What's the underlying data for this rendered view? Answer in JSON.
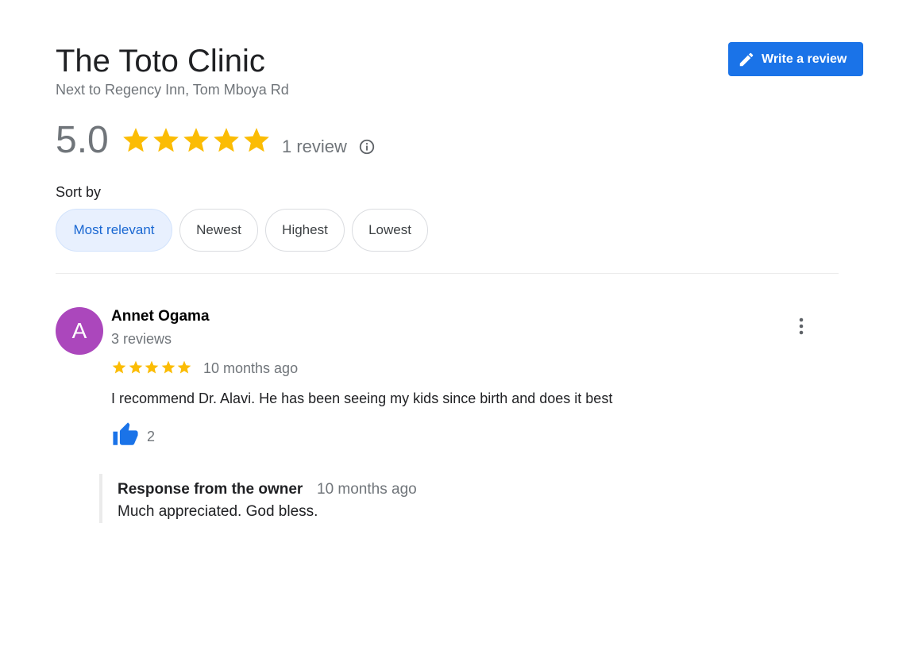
{
  "place": {
    "name": "The Toto Clinic",
    "address": "Next to Regency Inn, Tom Mboya Rd"
  },
  "actions": {
    "write_review_label": "Write a review",
    "write_review_icon": "pencil-icon"
  },
  "rating": {
    "score": "5.0",
    "stars": 5,
    "review_count": "1 review",
    "info_icon": "info-icon",
    "star_color": "#fbbc04"
  },
  "sort": {
    "label": "Sort by",
    "options": [
      "Most relevant",
      "Newest",
      "Highest",
      "Lowest"
    ],
    "selected": "Most relevant"
  },
  "review": {
    "avatar_letter": "A",
    "avatar_color": "#ab47bc",
    "author": "Annet Ogama",
    "author_reviews": "3 reviews",
    "stars": 5,
    "time": "10 months ago",
    "text": "I recommend Dr. Alavi. He has been seeing my kids since birth and does it best",
    "likes": "2",
    "like_icon": "thumbs-up-icon",
    "more_icon": "more-vert-icon",
    "owner_response": {
      "label": "Response from the owner",
      "time": "10 months ago",
      "text": "Much appreciated. God bless."
    }
  },
  "colors": {
    "accent": "#1a73e8",
    "chip_selected_bg": "#e8f0fe",
    "chip_selected_text": "#1967d2"
  }
}
